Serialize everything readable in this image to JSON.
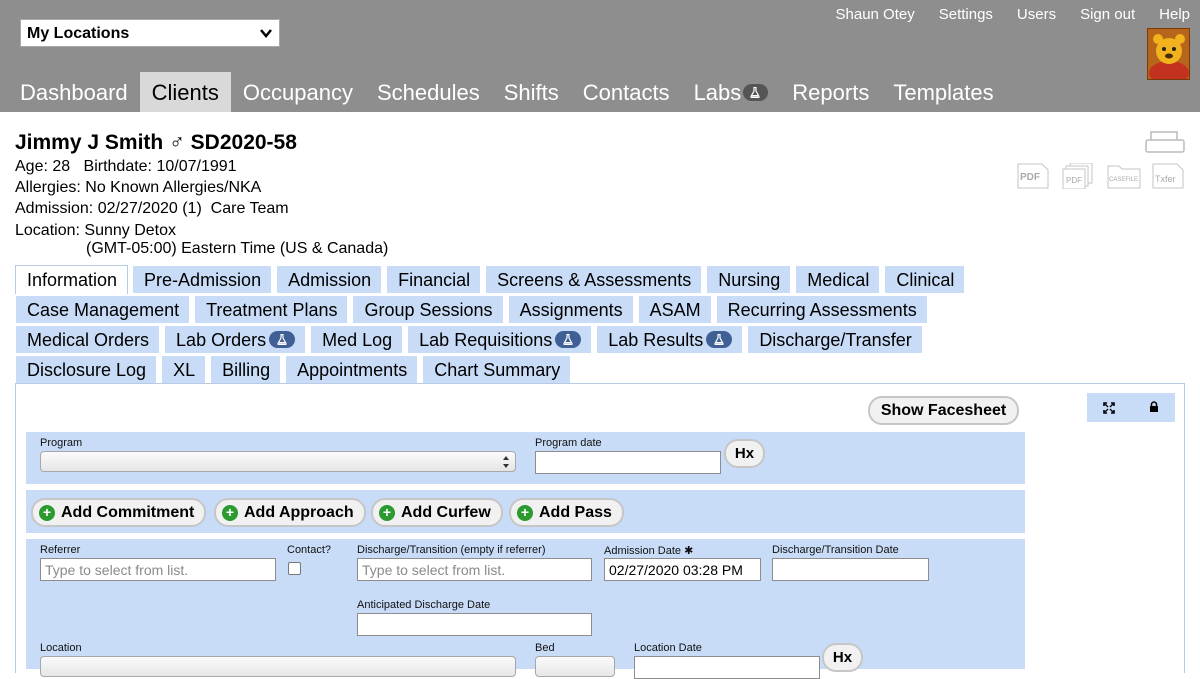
{
  "header": {
    "location_select": "My Locations",
    "user_links": [
      "Shaun Otey",
      "Settings",
      "Users",
      "Sign out",
      "Help"
    ],
    "nav": [
      {
        "label": "Dashboard",
        "active": false,
        "badge": false
      },
      {
        "label": "Clients",
        "active": true,
        "badge": false
      },
      {
        "label": "Occupancy",
        "active": false,
        "badge": false
      },
      {
        "label": "Schedules",
        "active": false,
        "badge": false
      },
      {
        "label": "Shifts",
        "active": false,
        "badge": false
      },
      {
        "label": "Contacts",
        "active": false,
        "badge": false
      },
      {
        "label": "Labs",
        "active": false,
        "badge": true
      },
      {
        "label": "Reports",
        "active": false,
        "badge": false
      },
      {
        "label": "Templates",
        "active": false,
        "badge": false
      }
    ]
  },
  "client": {
    "name": "Jimmy J Smith",
    "gender_symbol": "♂",
    "id": "SD2020-58",
    "age_label": "Age:",
    "age": "28",
    "birthdate_label": "Birthdate:",
    "birthdate": "10/07/1991",
    "allergies_label": "Allergies:",
    "allergies": "No Known Allergies/NKA",
    "admission_label": "Admission:",
    "admission": "02/27/2020 (1)",
    "care_team": "Care Team",
    "location_label": "Location:",
    "location": "Sunny Detox",
    "timezone": "(GMT-05:00) Eastern Time (US & Canada)"
  },
  "doc_icons": [
    "PDF",
    "PDF",
    "CASEFILE",
    "Txfer"
  ],
  "tabs": [
    [
      {
        "label": "Information",
        "active": true
      },
      {
        "label": "Pre-Admission"
      },
      {
        "label": "Admission"
      },
      {
        "label": "Financial"
      },
      {
        "label": "Screens & Assessments"
      },
      {
        "label": "Nursing"
      },
      {
        "label": "Medical"
      },
      {
        "label": "Clinical"
      }
    ],
    [
      {
        "label": "Case Management"
      },
      {
        "label": "Treatment Plans"
      },
      {
        "label": "Group Sessions"
      },
      {
        "label": "Assignments"
      },
      {
        "label": "ASAM"
      },
      {
        "label": "Recurring Assessments"
      }
    ],
    [
      {
        "label": "Medical Orders"
      },
      {
        "label": "Lab Orders",
        "badge": true
      },
      {
        "label": "Med Log"
      },
      {
        "label": "Lab Requisitions",
        "badge": true
      },
      {
        "label": "Lab Results",
        "badge": true
      },
      {
        "label": "Discharge/Transfer"
      }
    ],
    [
      {
        "label": "Disclosure Log"
      },
      {
        "label": "XL"
      },
      {
        "label": "Billing"
      },
      {
        "label": "Appointments"
      },
      {
        "label": "Chart Summary"
      }
    ]
  ],
  "panel": {
    "show_facesheet": "Show Facesheet",
    "program_label": "Program",
    "program_value": "",
    "program_date_label": "Program date",
    "program_date_value": "",
    "hx_label": "Hx",
    "add_buttons": [
      "Add Commitment",
      "Add Approach",
      "Add Curfew",
      "Add Pass"
    ],
    "referrer_label": "Referrer",
    "referrer_placeholder": "Type to select from list.",
    "contact_label": "Contact?",
    "discharge_transition_label": "Discharge/Transition (empty if referrer)",
    "discharge_transition_placeholder": "Type to select from list.",
    "admission_date_label": "Admission Date ✱",
    "admission_date_value": "02/27/2020 03:28 PM",
    "discharge_date_label": "Discharge/Transition Date",
    "discharge_date_value": "",
    "anticipated_discharge_label": "Anticipated Discharge Date",
    "anticipated_discharge_value": "",
    "location_label": "Location",
    "bed_label": "Bed",
    "location_date_label": "Location Date"
  },
  "colors": {
    "header_bg": "#8e8e8e",
    "tab_bg": "#c9dcf7",
    "badge_bg": "#3f5f95",
    "add_icon": "#2b9a2f"
  }
}
